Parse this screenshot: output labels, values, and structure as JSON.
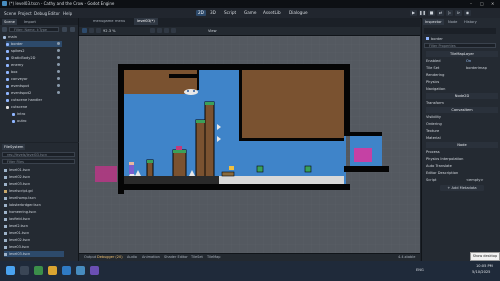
{
  "window": {
    "title": "(*) level03.tscn - Cathy and the Crow - Godot Engine"
  },
  "menu": [
    "Scene",
    "Project",
    "Debug",
    "Editor",
    "Help"
  ],
  "workspaces": [
    "2D",
    "3D",
    "Script",
    "Game",
    "AssetLib",
    "Dialogue"
  ],
  "left_dock": {
    "tabs": [
      "Scene",
      "Import"
    ],
    "filter_placeholder": "Filter: Name, t:Type",
    "nodes": [
      {
        "label": "main",
        "color": "#e0e0e0"
      },
      {
        "label": "border",
        "color": "#8fb5ff"
      },
      {
        "label": "spikes2",
        "color": "#8fb5ff"
      },
      {
        "label": "StaticBody2D",
        "color": "#8fb5ff"
      },
      {
        "label": "enemy",
        "color": "#8fb5ff"
      },
      {
        "label": "box",
        "color": "#8fb5ff"
      },
      {
        "label": "conveyor",
        "color": "#8fb5ff"
      },
      {
        "label": "eventspot",
        "color": "#8fb5ff"
      },
      {
        "label": "eventspot2",
        "color": "#8fb5ff"
      },
      {
        "label": "cutscene handler",
        "color": "#8fb5ff"
      },
      {
        "label": "cutscene",
        "color": "#e0e0e0"
      },
      {
        "label": "intro",
        "color": "#8fb5ff"
      },
      {
        "label": "outro",
        "color": "#8fb5ff"
      }
    ],
    "filesystem": {
      "title": "FileSystem",
      "path": "res://levels/level03.tscn",
      "filter_placeholder": "Filter Files",
      "files": [
        "level01.tscn",
        "level02.tscn",
        "level03.tscn",
        "levelscript.gd",
        "levelhomp.tscn",
        "lobsterbrdger.tscn",
        "homeering.tscn",
        "lavfield.tscn",
        "level2.tscn",
        "leve01.tscn",
        "level02.tscn",
        "leve03.tscn",
        "level03.tscn"
      ]
    }
  },
  "scene_tabs": [
    "menugame",
    "menu",
    "level03(*)"
  ],
  "viewport": {
    "zoom": "92.3 %",
    "view_label": "View"
  },
  "inspector": {
    "tabs": [
      "Inspector",
      "Node",
      "History"
    ],
    "node_name": "border",
    "filter_placeholder": "Filter Properties",
    "class_name": "TileMapLayer",
    "rows": [
      {
        "label": "Enabled",
        "value": "On"
      },
      {
        "label": "Tile Set",
        "value": "borderimap"
      }
    ],
    "sections": [
      "Rendering",
      "Physics",
      "Navigation",
      "Node2D",
      "Transform",
      "CanvasItem",
      "Visibility",
      "Ordering",
      "Texture",
      "Material",
      "Node",
      "Process",
      "Physics Interpolation",
      "Auto Translate",
      "Editor Description"
    ],
    "script_label": "Script",
    "script_value": "<empty>",
    "add_metadata": "Add Metadata"
  },
  "bottom_panel": {
    "tabs": [
      "Output",
      "Debugger (20)",
      "Audio",
      "Animation",
      "Shader Editor",
      "TileSet",
      "TileMap"
    ],
    "version": "4.4.stable"
  },
  "taskbar": {
    "tooltip": "Show desktop",
    "lang": "ENG",
    "time": "10:05 PM",
    "date": "5/10/2025"
  }
}
